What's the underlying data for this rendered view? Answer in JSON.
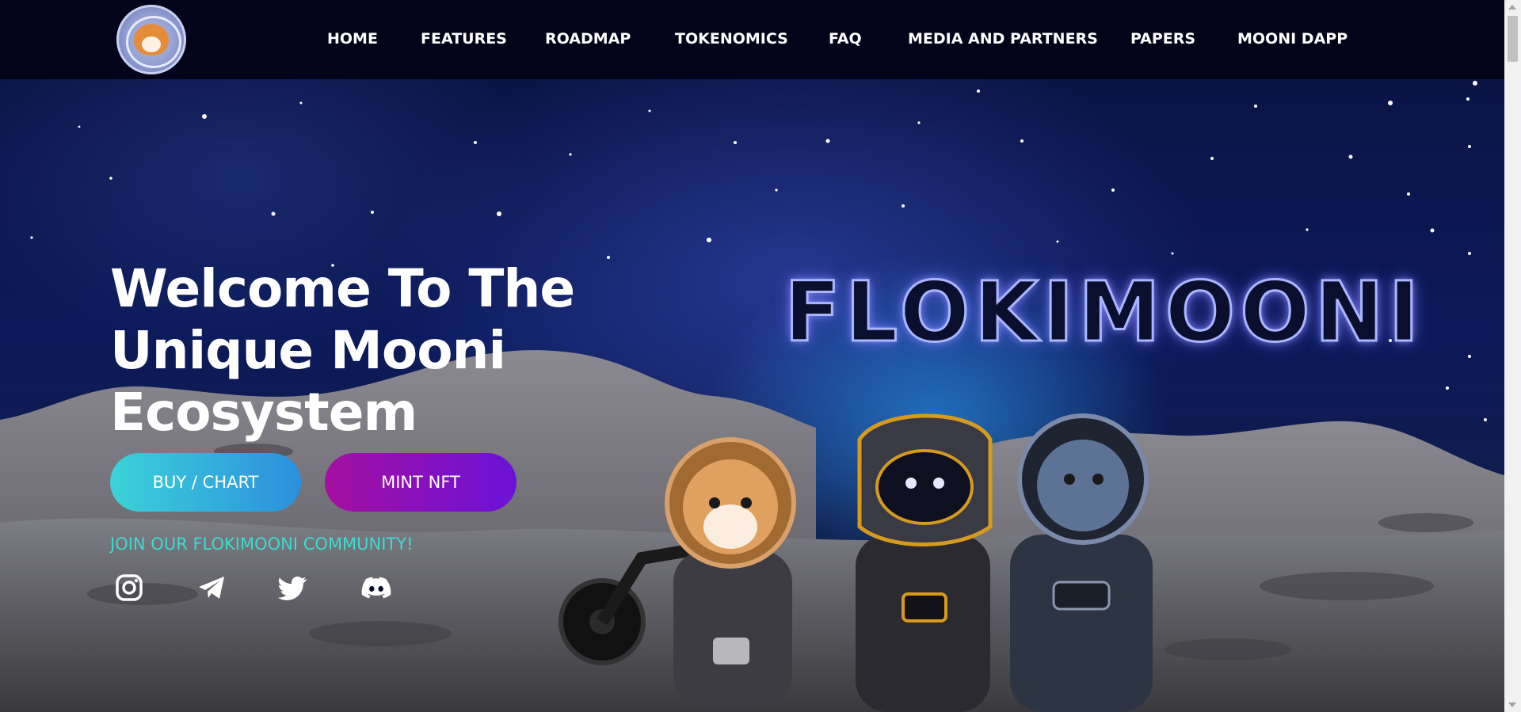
{
  "nav": {
    "items": [
      {
        "label": "HOME"
      },
      {
        "label": "FEATURES"
      },
      {
        "label": "ROADMAP"
      },
      {
        "label": "TOKENOMICS"
      },
      {
        "label": "FAQ"
      },
      {
        "label": "MEDIA AND PARTNERS"
      },
      {
        "label": "PAPERS"
      },
      {
        "label": "MOONI DAPP"
      }
    ]
  },
  "hero": {
    "headline_line1": "Welcome To The",
    "headline_line2": "Unique Mooni",
    "headline_line3": "Ecosystem",
    "buy_label": "BUY / CHART",
    "mint_label": "MINT NFT",
    "community_text": "JOIN OUR FLOKIMOONI COMMUNITY!",
    "brand_logo_text": "FLOKIMOONI",
    "social_icons": [
      "instagram-icon",
      "telegram-icon",
      "twitter-icon",
      "discord-icon"
    ]
  },
  "colors": {
    "nav_bg": "#03031a",
    "buy_gradient": [
      "#3cd2d8",
      "#2b8fdd"
    ],
    "mint_gradient": [
      "#a410a0",
      "#6b12d8"
    ],
    "community_text": "#3ddbd0"
  }
}
